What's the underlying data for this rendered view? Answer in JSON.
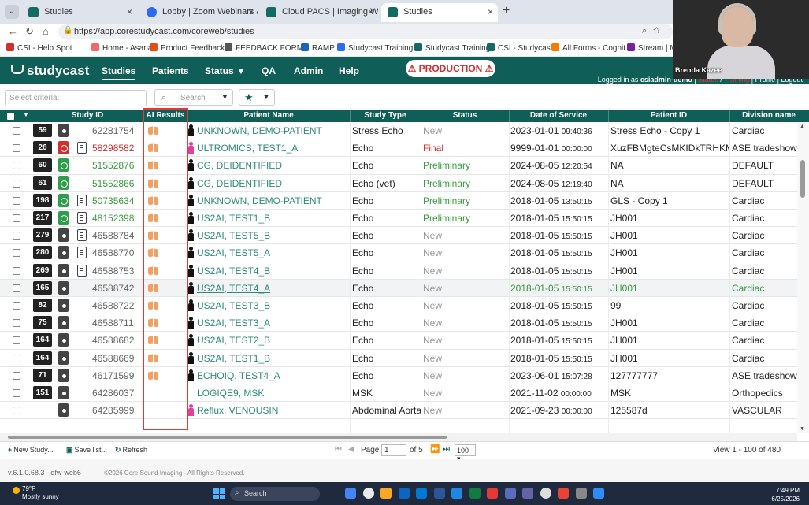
{
  "browser": {
    "tabs": [
      {
        "label": "Studies",
        "favicon": "studycast-icon",
        "active": false
      },
      {
        "label": "Lobby | Zoom Webinars & Events",
        "favicon": "zoom-icon",
        "active": false
      },
      {
        "label": "Cloud PACS | Imaging Workflow F",
        "favicon": "studycast-icon",
        "active": false
      },
      {
        "label": "Studies",
        "favicon": "studycast-icon",
        "active": true
      }
    ],
    "url": "https://app.corestudycast.com/coreweb/studies",
    "bookmarks": [
      "CSI - Help Spot",
      "Home - Asana",
      "Product Feedback...",
      "FEEDBACK FORM...",
      "RAMP",
      "Studycast Training...",
      "Studycast Training...",
      "CSI - Studycast",
      "All Forms - Cognit...",
      "Stream | Micr"
    ]
  },
  "app": {
    "logo": "studycast",
    "nav": [
      {
        "label": "Studies",
        "active": true
      },
      {
        "label": "Patients",
        "active": false
      },
      {
        "label": "Status ▼",
        "active": false
      },
      {
        "label": "QA",
        "active": false
      },
      {
        "label": "Admin",
        "active": false
      },
      {
        "label": "Help",
        "active": false
      }
    ],
    "production_badge": "⚠ PRODUCTION ⚠",
    "logged_in_prefix": "Logged in as",
    "logged_in_user": "csiadmin-demo",
    "user_links": [
      "Status",
      "Training",
      "Profile",
      "Logout"
    ]
  },
  "toolbar": {
    "criteria_placeholder": "Select criteria:",
    "search_placeholder": "Search"
  },
  "grid": {
    "columns": [
      "Study ID",
      "AI Results",
      "Patient Name",
      "Study Type",
      "Status",
      "Date of Service",
      "Patient ID",
      "Division name"
    ],
    "rows": [
      {
        "count": "59",
        "clip": "dark",
        "doc": false,
        "study_id": "62281754",
        "id_color": "gray",
        "ai": true,
        "sex": "m",
        "patient": "UNKNOWN, DEMO-PATIENT",
        "type": "Stress Echo",
        "status": "New",
        "date": "2023-01-01",
        "time": "09:40:36",
        "pid": "Stress Echo - Copy 1",
        "division": "Cardiac"
      },
      {
        "count": "26",
        "clip": "red",
        "doc": true,
        "study_id": "58298582",
        "id_color": "red",
        "ai": true,
        "sex": "f",
        "patient": "ULTROMICS, TEST1_A",
        "type": "Echo",
        "status": "Final",
        "date": "9999-01-01",
        "time": "00:00:00",
        "pid": "XuzFBMgteCsMKIDkTRHKM",
        "division": "ASE tradeshow"
      },
      {
        "count": "60",
        "clip": "green",
        "doc": false,
        "study_id": "51552876",
        "id_color": "green",
        "ai": true,
        "sex": "m",
        "patient": "CG, DEIDENTIFIED",
        "type": "Echo",
        "status": "Preliminary",
        "date": "2024-08-05",
        "time": "12:20:54",
        "pid": "NA",
        "division": "DEFAULT"
      },
      {
        "count": "61",
        "clip": "green",
        "doc": false,
        "study_id": "51552866",
        "id_color": "green",
        "ai": true,
        "sex": "m",
        "patient": "CG, DEIDENTIFIED",
        "type": "Echo (vet)",
        "status": "Preliminary",
        "date": "2024-08-05",
        "time": "12:19:40",
        "pid": "NA",
        "division": "DEFAULT"
      },
      {
        "count": "198",
        "clip": "green",
        "doc": true,
        "study_id": "50735634",
        "id_color": "green",
        "ai": true,
        "sex": "m",
        "patient": "UNKNOWN, DEMO-PATIENT",
        "type": "Echo",
        "status": "Preliminary",
        "date": "2018-01-05",
        "time": "13:50:15",
        "pid": "GLS - Copy 1",
        "division": "Cardiac"
      },
      {
        "count": "217",
        "clip": "green",
        "doc": true,
        "study_id": "48152398",
        "id_color": "green",
        "ai": true,
        "sex": "m",
        "patient": "US2AI, TEST1_B",
        "type": "Echo",
        "status": "Preliminary",
        "date": "2018-01-05",
        "time": "15:50:15",
        "pid": "JH001",
        "division": "Cardiac"
      },
      {
        "count": "279",
        "clip": "dark",
        "doc": true,
        "study_id": "46588784",
        "id_color": "gray",
        "ai": true,
        "sex": "m",
        "patient": "US2AI, TEST5_B",
        "type": "Echo",
        "status": "New",
        "date": "2018-01-05",
        "time": "15:50:15",
        "pid": "JH001",
        "division": "Cardiac"
      },
      {
        "count": "280",
        "clip": "dark",
        "doc": true,
        "study_id": "46588770",
        "id_color": "gray",
        "ai": true,
        "sex": "m",
        "patient": "US2AI, TEST5_A",
        "type": "Echo",
        "status": "New",
        "date": "2018-01-05",
        "time": "15:50:15",
        "pid": "JH001",
        "division": "Cardiac"
      },
      {
        "count": "269",
        "clip": "dark",
        "doc": true,
        "study_id": "46588753",
        "id_color": "gray",
        "ai": true,
        "sex": "m",
        "patient": "US2AI, TEST4_B",
        "type": "Echo",
        "status": "New",
        "date": "2018-01-05",
        "time": "15:50:15",
        "pid": "JH001",
        "division": "Cardiac"
      },
      {
        "count": "165",
        "clip": "dark",
        "doc": false,
        "study_id": "46588742",
        "id_color": "gray",
        "ai": true,
        "sex": "m",
        "patient": "US2AI, TEST4_A",
        "type": "Echo",
        "status": "New",
        "date": "2018-01-05",
        "time": "15:50:15",
        "pid": "JH001",
        "division": "Cardiac",
        "highlight": true
      },
      {
        "count": "82",
        "clip": "dark",
        "doc": false,
        "study_id": "46588722",
        "id_color": "gray",
        "ai": true,
        "sex": "m",
        "patient": "US2AI, TEST3_B",
        "type": "Echo",
        "status": "New",
        "date": "2018-01-05",
        "time": "15:50:15",
        "pid": "99",
        "division": "Cardiac"
      },
      {
        "count": "75",
        "clip": "dark",
        "doc": false,
        "study_id": "46588711",
        "id_color": "gray",
        "ai": true,
        "sex": "m",
        "patient": "US2AI, TEST3_A",
        "type": "Echo",
        "status": "New",
        "date": "2018-01-05",
        "time": "15:50:15",
        "pid": "JH001",
        "division": "Cardiac"
      },
      {
        "count": "164",
        "clip": "dark",
        "doc": false,
        "study_id": "46588682",
        "id_color": "gray",
        "ai": true,
        "sex": "m",
        "patient": "US2AI, TEST2_B",
        "type": "Echo",
        "status": "New",
        "date": "2018-01-05",
        "time": "15:50:15",
        "pid": "JH001",
        "division": "Cardiac"
      },
      {
        "count": "164",
        "clip": "dark",
        "doc": false,
        "study_id": "46588669",
        "id_color": "gray",
        "ai": true,
        "sex": "m",
        "patient": "US2AI, TEST1_B",
        "type": "Echo",
        "status": "New",
        "date": "2018-01-05",
        "time": "15:50:15",
        "pid": "JH001",
        "division": "Cardiac"
      },
      {
        "count": "71",
        "clip": "dark",
        "doc": false,
        "study_id": "46171599",
        "id_color": "gray",
        "ai": true,
        "sex": "m",
        "patient": "ECHOIQ, TEST4_A",
        "type": "Echo",
        "status": "New",
        "date": "2023-06-01",
        "time": "15:07:28",
        "pid": "127777777",
        "division": "ASE tradeshow"
      },
      {
        "count": "151",
        "clip": "dark",
        "doc": false,
        "study_id": "64286037",
        "id_color": "gray",
        "ai": false,
        "sex": "none",
        "patient": "LOGIQE9, MSK",
        "type": "MSK",
        "status": "New",
        "date": "2021-11-02",
        "time": "00:00:00",
        "pid": "MSK",
        "division": "Orthopedics"
      },
      {
        "count": "",
        "clip": "dark",
        "doc": false,
        "study_id": "64285999",
        "id_color": "gray",
        "ai": false,
        "sex": "f",
        "patient": "Reflux, VENOUSIN",
        "type": "Abdominal Aorta",
        "status": "New",
        "date": "2021-09-23",
        "time": "00:00:00",
        "pid": "125587d",
        "division": "VASCULAR"
      }
    ]
  },
  "pager": {
    "new_study": "New Study...",
    "save_list": "Save list...",
    "refresh": "Refresh",
    "page_label": "Page",
    "page_value": "1",
    "of_pages": "of 5",
    "per_page": "100 ▾",
    "view_info": "View 1 - 100 of 480"
  },
  "footer": {
    "version": "v.6.1.0.68.3 - dfw-web6",
    "copyright": "©2026 Core Sound Imaging - All Rights Reserved."
  },
  "taskbar": {
    "temp": "79°F",
    "weather": "Mostly sunny",
    "search": "Search",
    "time": "7:49 PM",
    "date": "6/25/2026"
  },
  "video": {
    "participant": "Brenda Kazee"
  },
  "colors": {
    "header_teal": "#0f5e57",
    "outline_red": "#e53935",
    "green_text": "#3a9a40",
    "red_text": "#d32f2f"
  }
}
